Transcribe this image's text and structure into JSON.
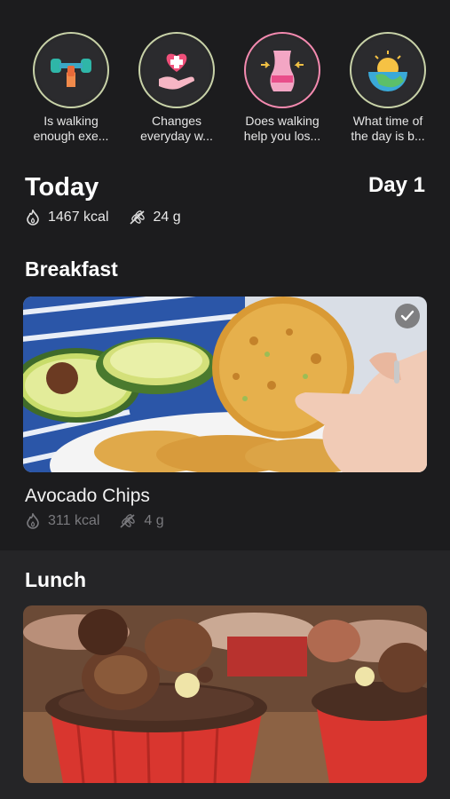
{
  "stories": [
    {
      "caption": "Is walking\nenough exe...",
      "icon": "dumbbell-icon"
    },
    {
      "caption": "Changes\neveryday w...",
      "icon": "heart-hand-icon"
    },
    {
      "caption": "Does walking\nhelp you los...",
      "icon": "waist-icon"
    },
    {
      "caption": "What time of\nthe day is b...",
      "icon": "sunrise-icon"
    }
  ],
  "today": {
    "title": "Today",
    "day": "Day 1",
    "calories": "1467 kcal",
    "carbs": "24 g"
  },
  "meals": [
    {
      "section": "Breakfast",
      "name": "Avocado Chips",
      "calories": "311 kcal",
      "carbs": "4 g",
      "completed": true
    },
    {
      "section": "Lunch"
    }
  ],
  "colors": {
    "background": "#1c1c1e",
    "lunch_background": "#252527",
    "muted_text": "#7a7a7e",
    "story_ring": "#c8d2a8"
  }
}
